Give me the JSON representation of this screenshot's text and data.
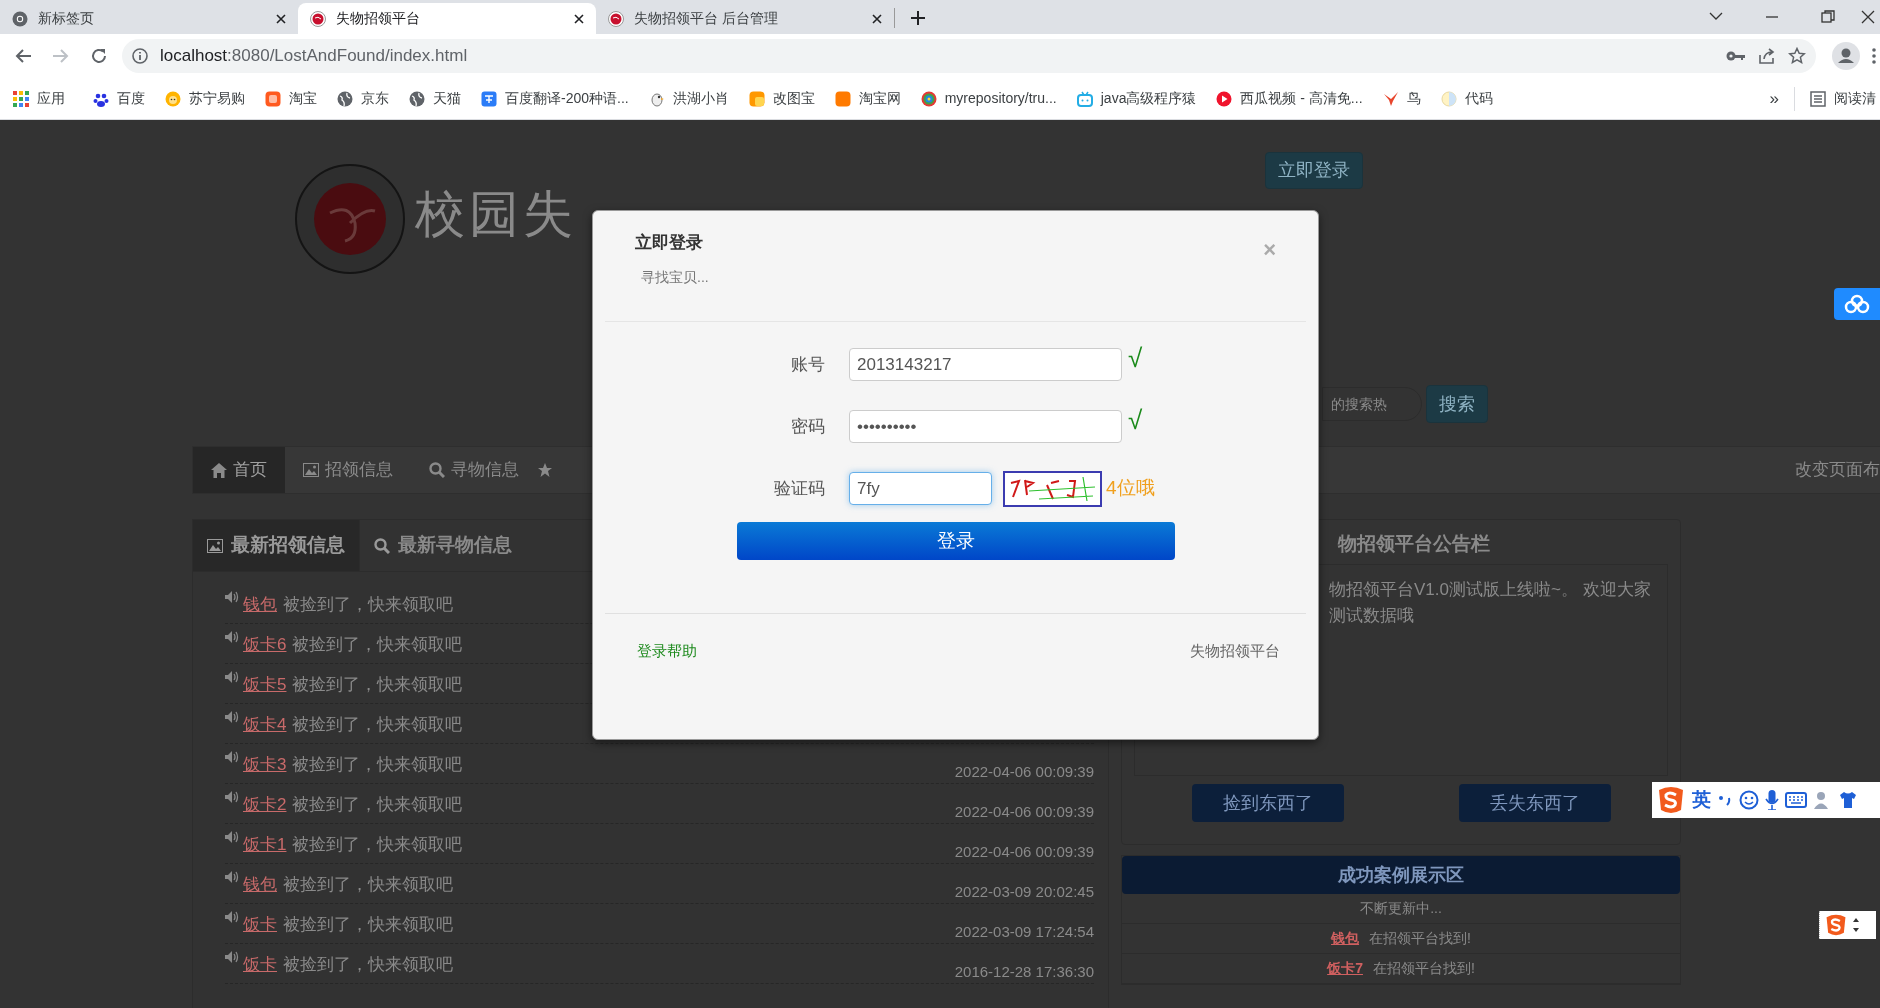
{
  "browser": {
    "tabs": [
      {
        "title": "新标签页",
        "selected": false
      },
      {
        "title": "失物招领平台",
        "selected": true
      },
      {
        "title": "失物招领平台 后台管理",
        "selected": false
      }
    ],
    "url_host": "localhost",
    "url_rest": ":8080/LostAndFound/index.html",
    "bookmarks": [
      "应用",
      "百度",
      "苏宁易购",
      "淘宝",
      "京东",
      "天猫",
      "百度翻译-200种语...",
      "洪湖小肖",
      "改图宝",
      "淘宝网",
      "myrepository/tru...",
      "java高级程序猿",
      "西瓜视频 - 高清免...",
      "鸟",
      "代码"
    ],
    "overflow": "»",
    "reading_list": "阅读清"
  },
  "page": {
    "site_title": "校园失",
    "login_button": "立即登录",
    "search": {
      "placeholder": "的搜索热",
      "button": "搜索"
    },
    "nav": [
      {
        "label": "首页",
        "selected": true
      },
      {
        "label": "招领信息",
        "selected": false
      },
      {
        "label": "寻物信息",
        "selected": false
      }
    ],
    "layout_link": "改变页面布",
    "latest": {
      "tabs": [
        {
          "label": "最新招领信息",
          "selected": true
        },
        {
          "label": "最新寻物信息",
          "selected": false
        }
      ],
      "items": [
        {
          "name": "钱包",
          "text": "被捡到了，快来领取吧"
        },
        {
          "name": "饭卡6",
          "text": "被捡到了，快来领取吧"
        },
        {
          "name": "饭卡5",
          "text": "被捡到了，快来领取吧"
        },
        {
          "name": "饭卡4",
          "text": "被捡到了，快来领取吧"
        },
        {
          "name": "饭卡3",
          "text": "被捡到了，快来领取吧",
          "date": "2022-04-06 00:09:39"
        },
        {
          "name": "饭卡2",
          "text": "被捡到了，快来领取吧",
          "date": "2022-04-06 00:09:39"
        },
        {
          "name": "饭卡1",
          "text": "被捡到了，快来领取吧",
          "date": "2022-04-06 00:09:39"
        },
        {
          "name": "钱包",
          "text": "被捡到了，快来领取吧",
          "date": "2022-03-09 20:02:45"
        },
        {
          "name": "饭卡",
          "text": "被捡到了，快来领取吧",
          "date": "2022-03-09 17:24:54"
        },
        {
          "name": "饭卡",
          "text": "被捡到了，快来领取吧",
          "date": "2016-12-28 17:36:30"
        }
      ]
    },
    "notice": {
      "title": "物招领平台公告栏",
      "lines": [
        "物招领平台V1.0测试版上线啦~。 欢迎大家",
        "测试数据哦"
      ],
      "buttons": [
        "捡到东西了",
        "丢失东西了"
      ]
    },
    "cases": {
      "title": "成功案例展示区",
      "note": "不断更新中...",
      "rows": [
        {
          "name": "钱包",
          "text": "在招领平台找到!"
        },
        {
          "name": "饭卡7",
          "text": "在招领平台找到!"
        }
      ]
    }
  },
  "login": {
    "title": "立即登录",
    "close": "×",
    "subtitle": "寻找宝贝...",
    "fields": [
      {
        "label": "账号",
        "value": "2013143217",
        "check": "√",
        "focused": false
      },
      {
        "label": "密码",
        "value": "••••••••••",
        "check": "√",
        "focused": false
      },
      {
        "label": "验证码",
        "value": "7fy",
        "hint": "4位哦",
        "focused": true
      }
    ],
    "submit": "登录",
    "help": "登录帮助",
    "footer": "失物招领平台"
  },
  "ime": {
    "mode": "英"
  }
}
